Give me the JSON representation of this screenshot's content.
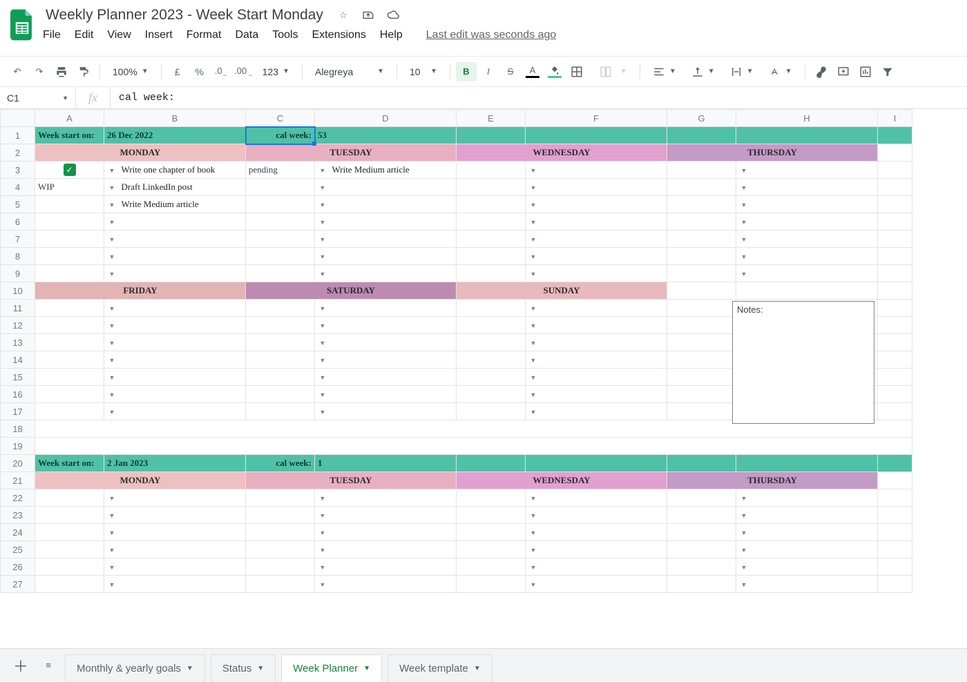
{
  "doc": {
    "title": "Weekly Planner 2023 - Week Start Monday"
  },
  "menu": {
    "file": "File",
    "edit": "Edit",
    "view": "View",
    "insert": "Insert",
    "format": "Format",
    "data": "Data",
    "tools": "Tools",
    "extensions": "Extensions",
    "help": "Help",
    "last_edit": "Last edit was seconds ago"
  },
  "toolbar": {
    "zoom": "100%",
    "currency": "£",
    "percent": "%",
    "fmt_dec": ".0",
    "fmt_inc": ".00",
    "num_format": "123",
    "font": "Alegreya",
    "font_size": "10"
  },
  "namebox": "C1",
  "formula": "cal week:",
  "columns": [
    "A",
    "B",
    "C",
    "D",
    "E",
    "F",
    "G",
    "H",
    "I"
  ],
  "week1": {
    "start_label": "Week start on:",
    "start_date": "26 Dec 2022",
    "cal_label": "cal week:",
    "cal_value": "53",
    "days": {
      "mon": "MONDAY",
      "tue": "TUESDAY",
      "wed": "WEDNESDAY",
      "thu": "THURSDAY",
      "fri": "FRIDAY",
      "sat": "SATURDAY",
      "sun": "SUNDAY"
    },
    "tasks": {
      "b3": "Write one chapter of book",
      "b4": "Draft LinkedIn post",
      "b5": "Write Medium article",
      "d3": "Write Medium article"
    },
    "status": {
      "a3_checked": "✓",
      "a4": "WIP",
      "c3": "pending"
    },
    "notes_label": "Notes:"
  },
  "week2": {
    "start_label": "Week start on:",
    "start_date": "2 Jan 2023",
    "cal_label": "cal week:",
    "cal_value": "1",
    "days": {
      "mon": "MONDAY",
      "tue": "TUESDAY",
      "wed": "WEDNESDAY",
      "thu": "THURSDAY"
    }
  },
  "sheets": {
    "s1": "Monthly & yearly goals",
    "s2": "Status",
    "s3": "Week Planner",
    "s4": "Week template"
  }
}
